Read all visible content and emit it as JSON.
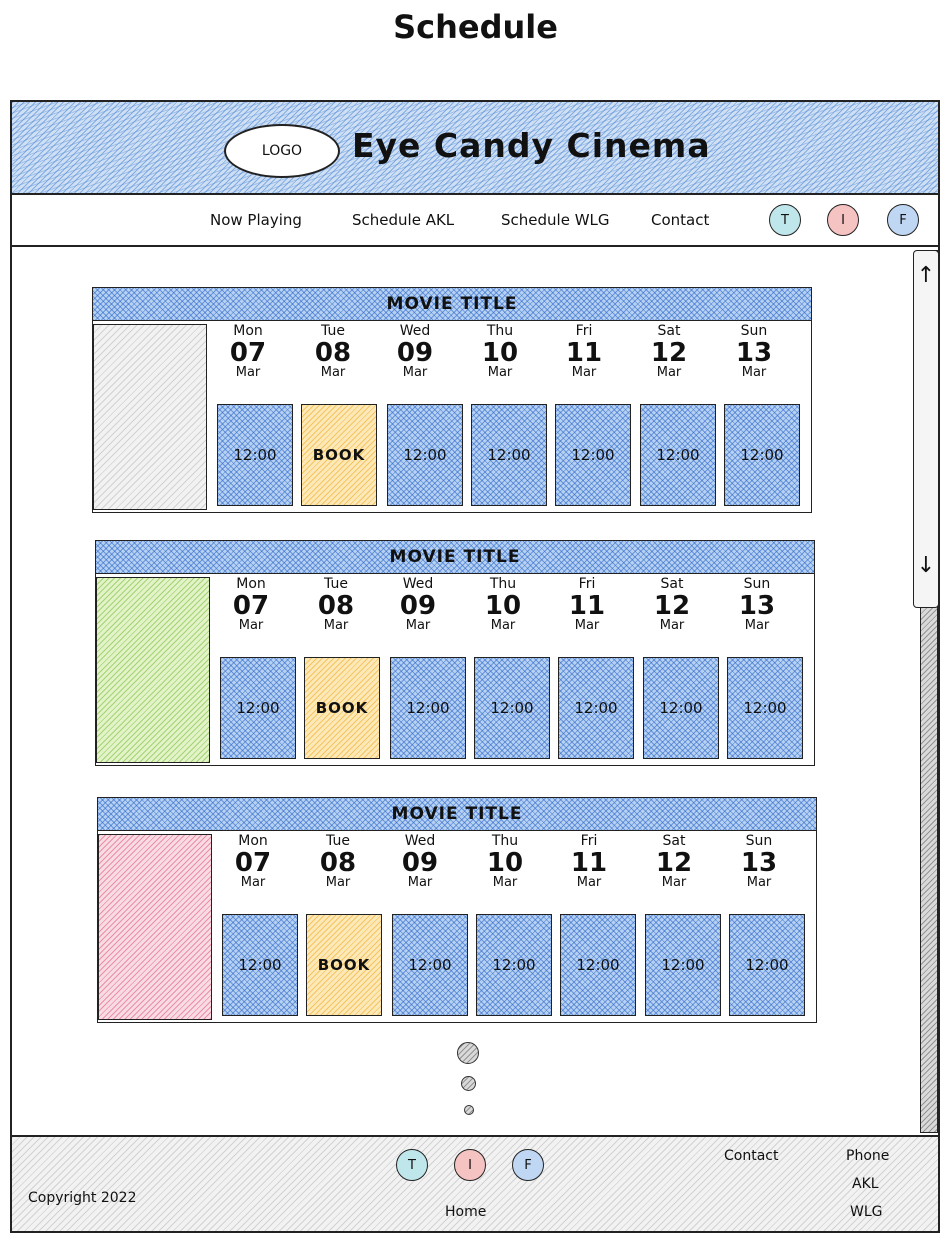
{
  "page": {
    "title": "Schedule"
  },
  "header": {
    "logo": "LOGO",
    "brand": "Eye Candy Cinema"
  },
  "nav": {
    "links": [
      "Now Playing",
      "Schedule AKL",
      "Schedule WLG",
      "Contact"
    ],
    "social": [
      {
        "label": "T",
        "icon": "twitter-icon",
        "color": "#bfe6ea"
      },
      {
        "label": "I",
        "icon": "instagram-icon",
        "color": "#f6c3c3"
      },
      {
        "label": "F",
        "icon": "facebook-icon",
        "color": "#bfd7f2"
      }
    ]
  },
  "days": [
    {
      "name": "Mon",
      "num": "07",
      "mon": "Mar"
    },
    {
      "name": "Tue",
      "num": "08",
      "mon": "Mar"
    },
    {
      "name": "Wed",
      "num": "09",
      "mon": "Mar"
    },
    {
      "name": "Thu",
      "num": "10",
      "mon": "Mar"
    },
    {
      "name": "Fri",
      "num": "11",
      "mon": "Mar"
    },
    {
      "name": "Sat",
      "num": "12",
      "mon": "Mar"
    },
    {
      "name": "Sun",
      "num": "13",
      "mon": "Mar"
    }
  ],
  "movies": [
    {
      "title": "MOVIE TITLE",
      "poster_color": "#f2f2f2",
      "slots": [
        "12:00",
        "BOOK",
        "12:00",
        "12:00",
        "12:00",
        "12:00",
        "12:00"
      ]
    },
    {
      "title": "MOVIE TITLE",
      "poster_color": "#e3f3c8",
      "slots": [
        "12:00",
        "BOOK",
        "12:00",
        "12:00",
        "12:00",
        "12:00",
        "12:00"
      ]
    },
    {
      "title": "MOVIE TITLE",
      "poster_color": "#f9dbe3",
      "slots": [
        "12:00",
        "BOOK",
        "12:00",
        "12:00",
        "12:00",
        "12:00",
        "12:00"
      ]
    }
  ],
  "scrollbar": {
    "up": "↑",
    "down": "↓"
  },
  "footer": {
    "copyright": "Copyright 2022",
    "home": "Home",
    "contact": "Contact",
    "phone": "Phone",
    "akl": "AKL",
    "wlg": "WLG",
    "social": [
      "T",
      "I",
      "F"
    ]
  }
}
